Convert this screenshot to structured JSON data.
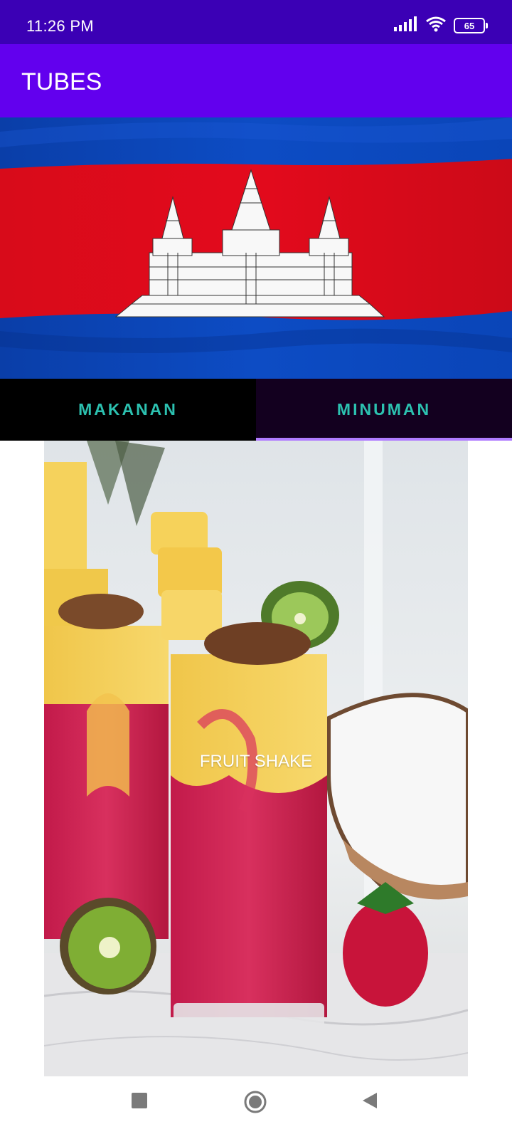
{
  "status_bar": {
    "time": "11:26 PM",
    "battery": "65"
  },
  "app_bar": {
    "title": "TUBES"
  },
  "hero": {
    "image": "cambodia-flag-banner"
  },
  "tabs": [
    {
      "label": "MAKANAN",
      "selected": false
    },
    {
      "label": "MINUMAN",
      "selected": true
    }
  ],
  "card": {
    "title": "FRUIT SHAKE",
    "image": "fruit-shake-photo"
  },
  "nav": {
    "recents_icon": "square-icon",
    "home_icon": "circle-icon",
    "back_icon": "triangle-back-icon"
  },
  "colors": {
    "status_bar": "#3b00b5",
    "app_bar": "#6200ee",
    "tab_text": "#2cc1b0",
    "tab_indicator": "#b07cff"
  }
}
